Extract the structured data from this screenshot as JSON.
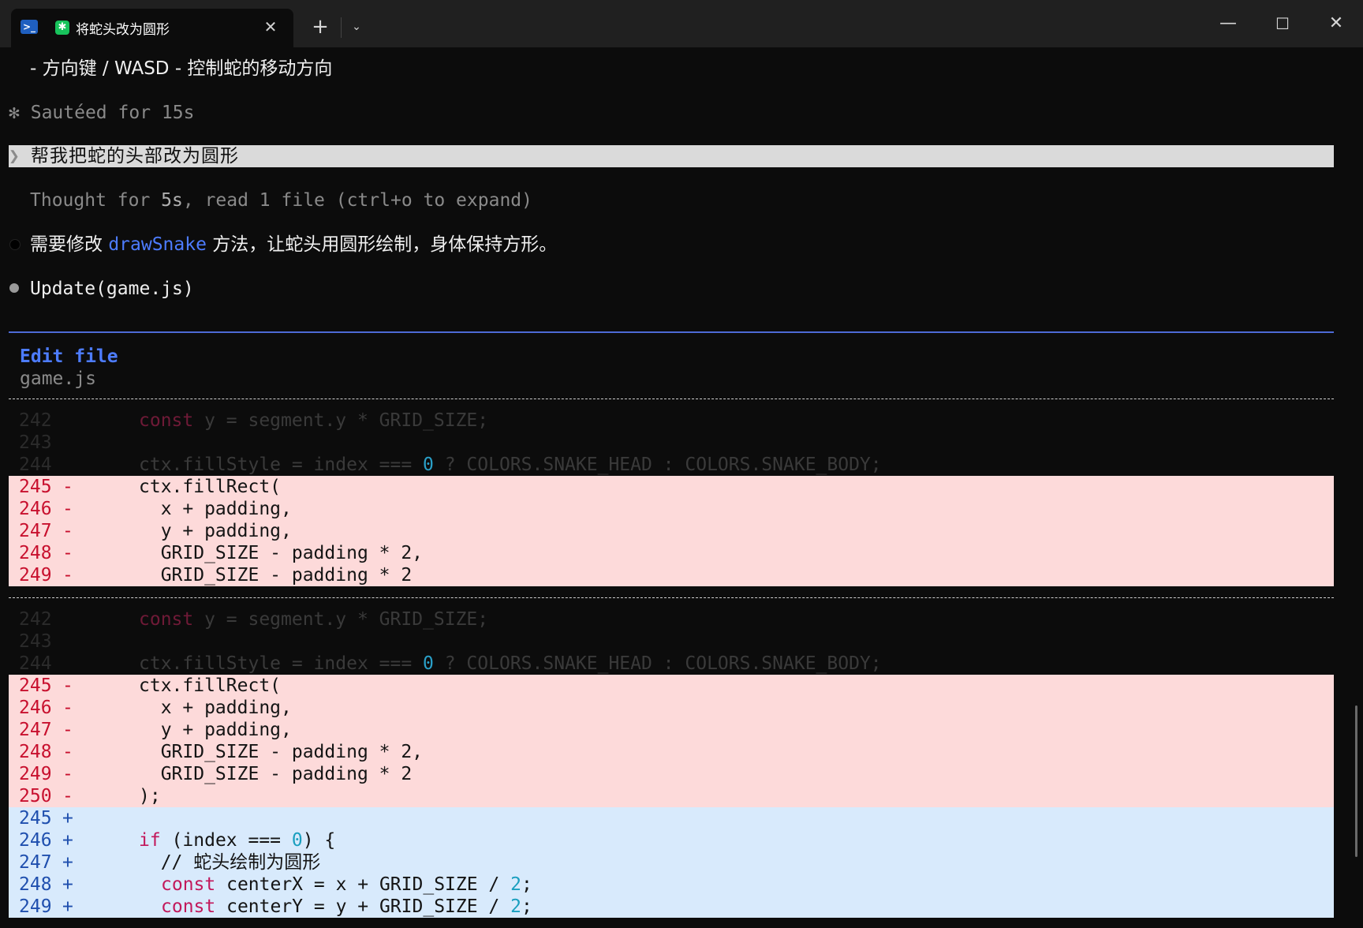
{
  "tab": {
    "title": "将蛇头改为圆形",
    "close": "✕"
  },
  "titlebar": {
    "new_tab": "+",
    "tab_menu": "⌄",
    "minimize": "—",
    "maximize": "☐",
    "close": "✕"
  },
  "transcript": {
    "controls_line": "- 方向键 / WASD - 控制蛇的移动方向",
    "status_star": "✻",
    "status": "Sautéed for 15s",
    "prompt_chevron": "❯",
    "prompt": "帮我把蛇的头部改为圆形",
    "thought_prefix": "Thought for ",
    "thought_time": "5s",
    "thought_suffix": ", read 1 file (ctrl+o to expand)",
    "msg_pre": "需要修改 ",
    "msg_fn": "drawSnake",
    "msg_post": " 方法，让蛇头用圆形绘制，身体保持方形。",
    "update": "Update(game.js)",
    "edit_title": "Edit file",
    "edit_file": "game.js"
  },
  "diff1": {
    "ctx": [
      {
        "n": "242",
        "kw": "const",
        "rest": " y = segment.y * GRID_SIZE;"
      },
      {
        "n": "243",
        "code": ""
      },
      {
        "n": "244",
        "pre": "ctx.fillStyle = index === ",
        "num": "0",
        "post": " ? COLORS.SNAKE_HEAD : COLORS.SNAKE_BODY;"
      }
    ],
    "del": [
      {
        "n": "245",
        "s": "-",
        "code": "ctx.fillRect("
      },
      {
        "n": "246",
        "s": "-",
        "code": "  x + padding,"
      },
      {
        "n": "247",
        "s": "-",
        "code": "  y + padding,"
      },
      {
        "n": "248",
        "s": "-",
        "code": "  GRID_SIZE - padding * 2,"
      },
      {
        "n": "249",
        "s": "-",
        "code": "  GRID_SIZE - padding * 2"
      }
    ]
  },
  "diff2": {
    "ctx": [
      {
        "n": "242",
        "kw": "const",
        "rest": " y = segment.y * GRID_SIZE;"
      },
      {
        "n": "243",
        "code": ""
      },
      {
        "n": "244",
        "pre": "ctx.fillStyle = index === ",
        "num": "0",
        "post": " ? COLORS.SNAKE_HEAD : COLORS.SNAKE_BODY;"
      }
    ],
    "del": [
      {
        "n": "245",
        "s": "-",
        "code": "ctx.fillRect("
      },
      {
        "n": "246",
        "s": "-",
        "code": "  x + padding,"
      },
      {
        "n": "247",
        "s": "-",
        "code": "  y + padding,"
      },
      {
        "n": "248",
        "s": "-",
        "code": "  GRID_SIZE - padding * 2,"
      },
      {
        "n": "249",
        "s": "-",
        "code": "  GRID_SIZE - padding * 2"
      },
      {
        "n": "250",
        "s": "-",
        "code": ");"
      }
    ],
    "add": [
      {
        "n": "245",
        "s": "+",
        "code": ""
      },
      {
        "n": "246",
        "s": "+",
        "kw": "if",
        "pre": " (index === ",
        "num": "0",
        "post": ") {"
      },
      {
        "n": "247",
        "s": "+",
        "cmt": "  // 蛇头绘制为圆形"
      },
      {
        "n": "248",
        "s": "+",
        "kw": "const",
        "pre": " centerX = x + GRID_SIZE / ",
        "num": "2",
        "post": ";"
      },
      {
        "n": "249",
        "s": "+",
        "kw": "const",
        "pre": " centerY = y + GRID_SIZE / ",
        "num": "2",
        "post": ";"
      }
    ]
  }
}
